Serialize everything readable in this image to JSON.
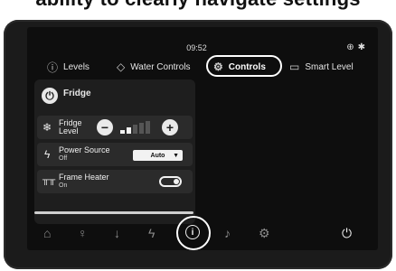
{
  "caption": "ability to clearly navigate settings",
  "status": {
    "time": "09:52",
    "globe_icon": "globe-icon",
    "bluetooth_icon": "bluetooth-icon"
  },
  "tabs": [
    {
      "label": "Levels",
      "icon": "info-icon"
    },
    {
      "label": "Water Controls",
      "icon": "water-drop-icon"
    },
    {
      "label": "Controls",
      "icon": "gears-icon",
      "active": true
    },
    {
      "label": "Smart Level",
      "icon": "level-indicator-icon"
    }
  ],
  "panel": {
    "title": "Fridge",
    "fridge_level": {
      "label_line1": "Fridge",
      "label_line2": "Level",
      "level": 2,
      "max": 5
    },
    "power_source": {
      "label": "Power Source",
      "status": "Off",
      "selected": "Auto"
    },
    "frame_heater": {
      "label": "Frame Heater",
      "status": "On",
      "enabled": true
    }
  },
  "dock": [
    "home-icon",
    "lightbulb-icon",
    "thermometer-icon",
    "power-bolt-icon",
    "info-icon",
    "music-note-icon",
    "settings-gear-icon",
    "power-icon"
  ],
  "colors": {
    "screen_bg": "#0e0e0e",
    "panel_bg": "#1e1e1e",
    "row_bg": "#2b2b2b",
    "highlight": "#ffffff"
  }
}
